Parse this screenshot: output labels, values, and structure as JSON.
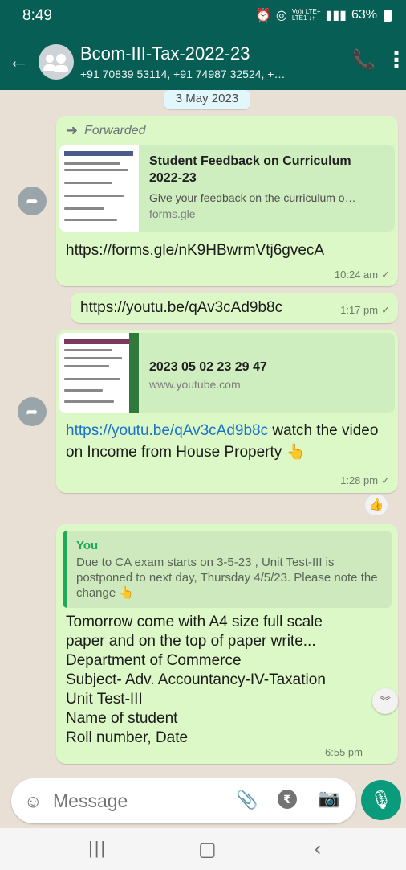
{
  "status_bar": {
    "time": "8:49",
    "signal_text": "Vo)) LTE+\nLTE1 ↓↑",
    "battery": "63%"
  },
  "header": {
    "title": "Bcom-III-Tax-2022-23",
    "subtitle": "+91 70839 53114, +91 74987 32524, +…"
  },
  "chat": {
    "date_chip": "3 May 2023",
    "messages": [
      {
        "forwarded_label": "Forwarded",
        "preview_title": "Student Feedback on Curriculum 2022-23",
        "preview_desc": "Give your feedback on the curriculum o…",
        "preview_domain": "forms.gle",
        "link": "https://forms.gle/nK9HBwrmVtj6gvecA",
        "time": "10:24 am"
      },
      {
        "link": "https://youtu.be/qAv3cAd9b8c",
        "time": "1:17 pm"
      },
      {
        "preview_title": "2023 05 02 23 29 47",
        "preview_domain": "www.youtube.com",
        "link": "https://youtu.be/qAv3cAd9b8c",
        "text_after_link": " watch the video on Income from House Property 👆",
        "time": "1:28 pm",
        "reaction": "👍"
      },
      {
        "quote_author": "You",
        "quote_text": "Due to CA exam starts on 3-5-23 , Unit Test-III is postponed to next day, Thursday 4/5/23. Please note the change 👆",
        "lines": [
          "Tomorrow come with A4 size full scale",
          "paper and on the top of paper write...",
          "Department of Commerce",
          "Subject- Adv. Accountancy-IV-Taxation",
          "Unit Test-III",
          "Name of student",
          "Roll number, Date"
        ],
        "time": "6:55 pm"
      }
    ]
  },
  "composer": {
    "placeholder": "Message"
  },
  "icons": {
    "back": "arrow-left",
    "call": "add-call",
    "menu": "more-vertical",
    "forward": "share-arrow",
    "emoji": "smile",
    "attach": "paperclip",
    "rupee": "rupee",
    "camera": "camera",
    "mic": "microphone",
    "scroll_down": "double-chevron-down"
  },
  "colors": {
    "header": "#075e54",
    "outgoing_bubble": "#dcf8c6",
    "link": "#1a73c8",
    "mic_button": "#0a9b7c",
    "quote_accent": "#1faa59"
  }
}
